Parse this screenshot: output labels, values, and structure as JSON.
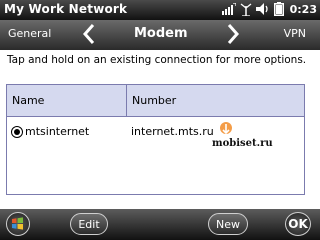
{
  "title_bar": {
    "title": "My Work Network",
    "clock": "0:23",
    "icons": [
      "signal-icon",
      "antenna-icon",
      "volume-icon",
      "battery-icon"
    ]
  },
  "tabs": {
    "prev_label": "General",
    "current_label": "Modem",
    "next_label": "VPN"
  },
  "hint_text": "Tap and hold on an existing connection for more options.",
  "table": {
    "columns": [
      "Name",
      "Number"
    ],
    "rows": [
      {
        "name": "mtsinternet",
        "number": "internet.mts.ru",
        "selected": true
      }
    ]
  },
  "watermark": "mobiset.ru",
  "softkeys": {
    "edit_label": "Edit",
    "new_label": "New",
    "ok_label": "OK"
  },
  "colors": {
    "header_fill": "#d5d9ef",
    "grid_border": "#7b7bae"
  }
}
